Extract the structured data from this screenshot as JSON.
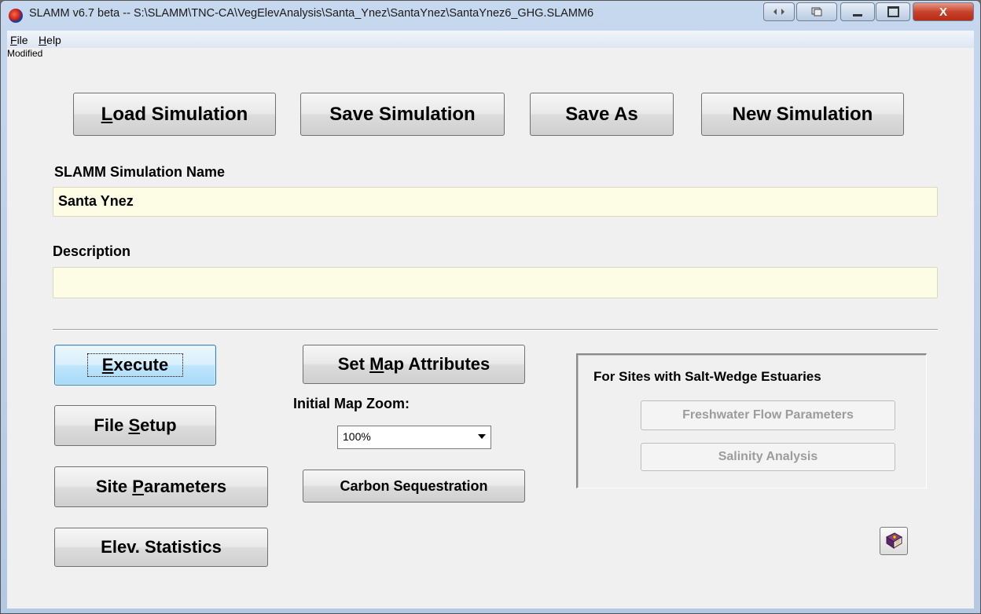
{
  "window": {
    "title": "SLAMM v6.7 beta -- S:\\SLAMM\\TNC-CA\\VegElevAnalysis\\Santa_Ynez\\SantaYnez\\SantaYnez6_GHG.SLAMM6",
    "restore_symbol": "▫",
    "minimize_symbol": "—",
    "maximize_symbol": "□",
    "close_symbol": "X"
  },
  "menu": {
    "file_u": "F",
    "file_rest": "ile",
    "help_u": "H",
    "help_rest": "elp"
  },
  "status": "Modified",
  "top_buttons": {
    "load_u": "L",
    "load_rest": "oad Simulation",
    "save": "Save Simulation",
    "save_as": "Save As",
    "new": "New Simulation"
  },
  "sim_name": {
    "label": "SLAMM Simulation Name",
    "value": "Santa Ynez"
  },
  "description": {
    "label": "Description",
    "value": ""
  },
  "left_buttons": {
    "execute_u": "E",
    "execute_rest": "xecute",
    "file_setup_pre": "File ",
    "file_setup_u": "S",
    "file_setup_rest": "etup",
    "site_params_pre": "Site ",
    "site_params_u": "P",
    "site_params_rest": "arameters",
    "elev_stats": "Elev. Statistics"
  },
  "middle": {
    "set_map_pre": "Set ",
    "set_map_u": "M",
    "set_map_rest": "ap Attributes",
    "zoom_label": "Initial Map Zoom:",
    "zoom_value": "100%",
    "carbon": "Carbon Sequestration"
  },
  "estuary": {
    "title": "For Sites with Salt-Wedge Estuaries",
    "freshwater": "Freshwater Flow Parameters",
    "salinity": "Salinity Analysis"
  },
  "help_icon": "help-book-icon",
  "colors": {
    "field_bg": "#fcfde4",
    "focused_btn": "#bee6fd",
    "disabled_text": "#9c9c9c"
  }
}
